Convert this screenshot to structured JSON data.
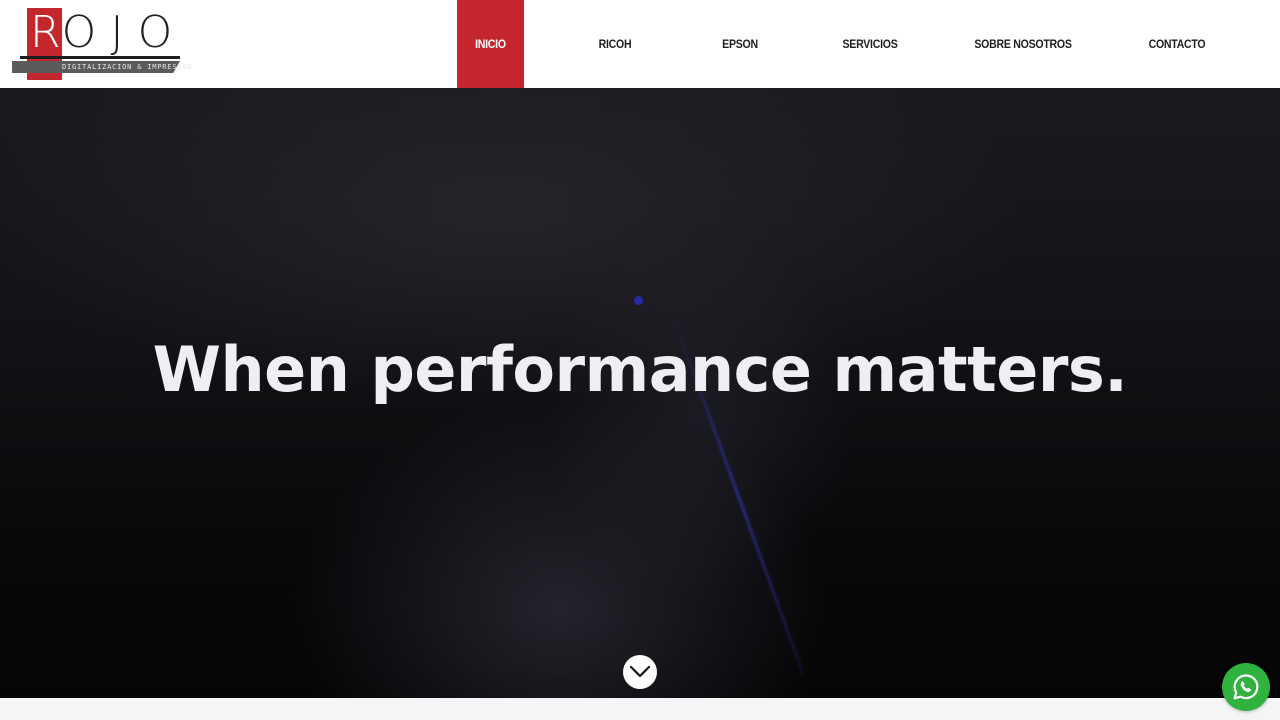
{
  "brand": {
    "letters": [
      "R",
      "O",
      "J",
      "O"
    ],
    "tagline": "DIGITALIZACION & IMPRESION",
    "accent_color": "#c4262e"
  },
  "nav": {
    "items": [
      {
        "label": "INICIO",
        "active": true
      },
      {
        "label": "RICOH",
        "active": false
      },
      {
        "label": "EPSON",
        "active": false
      },
      {
        "label": "SERVICIOS",
        "active": false
      },
      {
        "label": "SOBRE NOSOTROS",
        "active": false
      },
      {
        "label": "CONTACTO",
        "active": false
      }
    ]
  },
  "hero": {
    "title": "When performance matters.",
    "scroll_icon": "chevron-down-icon"
  },
  "floating": {
    "whatsapp_icon": "whatsapp-icon",
    "whatsapp_color": "#2fb33e"
  }
}
